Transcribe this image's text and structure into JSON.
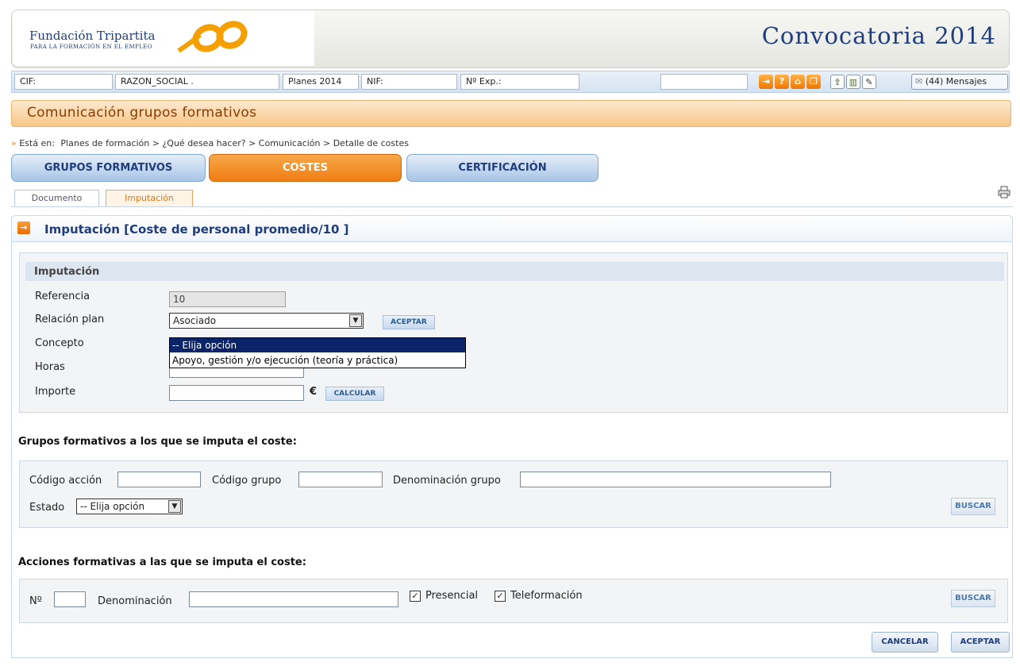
{
  "header": {
    "org_name": "Fundación Tripartita",
    "org_subtitle": "PARA LA FORMACIÓN EN EL EMPLEO",
    "title": "Convocatoria 2014"
  },
  "infobar": {
    "cif": "CIF:",
    "razon_social": "RAZON_SOCIAL .",
    "planes": "Planes 2014",
    "nif": "NIF:",
    "nexp": "Nº Exp.:",
    "search_value": "",
    "messages": "(44) Mensajes"
  },
  "section": {
    "title": "Comunicación grupos formativos"
  },
  "breadcrumb": {
    "prefix": "Está en:",
    "path": "Planes de formación > ¿Qué desea hacer? > Comunicación > Detalle de costes"
  },
  "tabs": [
    "GRUPOS FORMATIVOS",
    "COSTES",
    "CERTIFICACIÓN"
  ],
  "subtabs": [
    "Documento",
    "Imputación"
  ],
  "imputacion": {
    "bar_title": "Imputación [Coste de personal promedio/10 ]",
    "box_title": "Imputación",
    "referencia_label": "Referencia",
    "referencia_value": "10",
    "relacion_label": "Relación plan",
    "relacion_value": "Asociado",
    "aceptar_small": "ACEPTAR",
    "concepto_label": "Concepto",
    "concepto_options": [
      "-- Elija opción",
      "Apoyo, gestión y/o ejecución (teoría y práctica)"
    ],
    "horas_label": "Horas",
    "importe_label": "Importe",
    "currency": "€",
    "calcular": "CALCULAR"
  },
  "grupos": {
    "title": "Grupos formativos a los que se imputa el coste:",
    "codigo_accion_label": "Código acción",
    "codigo_grupo_label": "Código grupo",
    "denominacion_grupo_label": "Denominación grupo",
    "estado_label": "Estado",
    "estado_value": "-- Elija opción",
    "buscar": "BUSCAR"
  },
  "acciones": {
    "title": "Acciones formativas a las que se imputa el coste:",
    "numero_label": "Nº",
    "denominacion_label": "Denominación",
    "presencial_label": "Presencial",
    "teleformacion_label": "Teleformación",
    "presencial_checked": true,
    "teleformacion_checked": true,
    "buscar": "BUSCAR"
  },
  "footer": {
    "cancelar": "CANCELAR",
    "aceptar": "ACEPTAR"
  }
}
